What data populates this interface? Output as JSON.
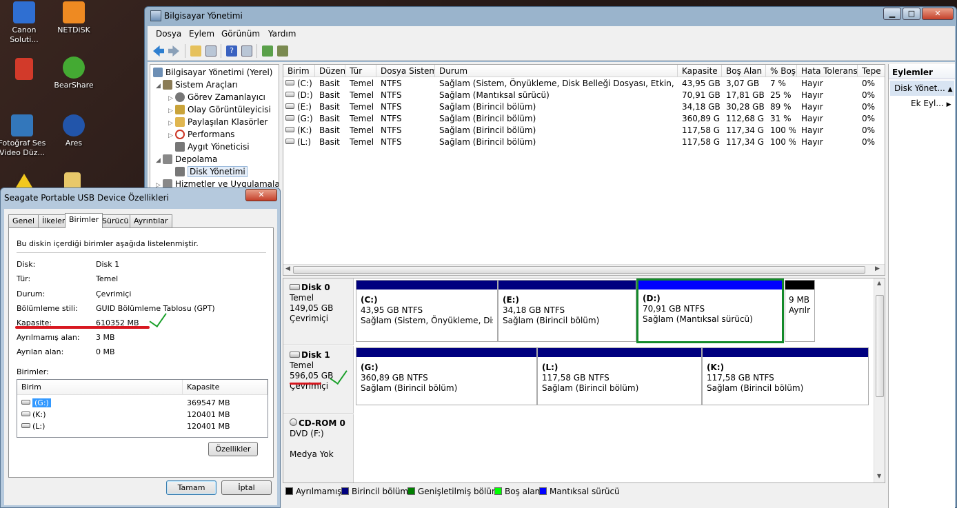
{
  "desktop": {
    "icons": [
      {
        "label": "Canon Soluti...",
        "color": "#2f6fd2"
      },
      {
        "label": "NETDiSK",
        "color": "#ee8a22"
      },
      {
        "label": "",
        "color": "#d23a2a"
      },
      {
        "label": "BearShare",
        "color": "#44aa33"
      },
      {
        "label": "Fotoğraf Ses Video Düz...",
        "color": "#3377bb"
      },
      {
        "label": "Ares",
        "color": "#2255aa"
      }
    ]
  },
  "window": {
    "title": "Bilgisayar Yönetimi",
    "menu": [
      "Dosya",
      "Eylem",
      "Görünüm",
      "Yardım"
    ]
  },
  "tree": {
    "items": [
      {
        "label": "Bilgisayar Yönetimi (Yerel)",
        "color": "#6d8fb5"
      },
      {
        "label": "Sistem Araçları",
        "color": "#8a7b55"
      },
      {
        "label": "Görev Zamanlayıcı",
        "color": "#777"
      },
      {
        "label": "Olay Görüntüleyicisi",
        "color": "#c9a33a"
      },
      {
        "label": "Paylaşılan Klasörler",
        "color": "#e0b650"
      },
      {
        "label": "Performans",
        "color": "#cc3322"
      },
      {
        "label": "Aygıt Yöneticisi",
        "color": "#777"
      },
      {
        "label": "Depolama",
        "color": "#888"
      },
      {
        "label": "Disk Yönetimi",
        "color": "#777"
      },
      {
        "label": "Hizmetler ve Uygulamalar",
        "color": "#888"
      }
    ]
  },
  "volumes": {
    "headers": [
      "Birim",
      "Düzen",
      "Tür",
      "Dosya Sistemi",
      "Durum",
      "Kapasite",
      "Boş Alan",
      "% Boş",
      "Hata Toleransı",
      "Tepe"
    ],
    "rows": [
      [
        "(C:)",
        "Basit",
        "Temel",
        "NTFS",
        "Sağlam (Sistem, Önyükleme, Disk Belleği Dosyası, Etkin, Kilitlen...",
        "43,95 GB",
        "3,07 GB",
        "7 %",
        "Hayır",
        "0%"
      ],
      [
        "(D:)",
        "Basit",
        "Temel",
        "NTFS",
        "Sağlam (Mantıksal sürücü)",
        "70,91 GB",
        "17,81 GB",
        "25 %",
        "Hayır",
        "0%"
      ],
      [
        "(E:)",
        "Basit",
        "Temel",
        "NTFS",
        "Sağlam (Birincil bölüm)",
        "34,18 GB",
        "30,28 GB",
        "89 %",
        "Hayır",
        "0%"
      ],
      [
        "(G:)",
        "Basit",
        "Temel",
        "NTFS",
        "Sağlam (Birincil bölüm)",
        "360,89 GB",
        "112,68 GB",
        "31 %",
        "Hayır",
        "0%"
      ],
      [
        "(K:)",
        "Basit",
        "Temel",
        "NTFS",
        "Sağlam (Birincil bölüm)",
        "117,58 GB",
        "117,34 GB",
        "100 %",
        "Hayır",
        "0%"
      ],
      [
        "(L:)",
        "Basit",
        "Temel",
        "NTFS",
        "Sağlam (Birincil bölüm)",
        "117,58 GB",
        "117,34 GB",
        "100 %",
        "Hayır",
        "0%"
      ]
    ]
  },
  "disks": [
    {
      "name": "Disk 0",
      "type": "Temel",
      "size": "149,05 GB",
      "status": "Çevrimiçi"
    },
    {
      "name": "Disk 1",
      "type": "Temel",
      "size": "596,05 GB",
      "status": "Çevrimiçi"
    },
    {
      "name": "CD-ROM 0",
      "type": "DVD (F:)",
      "size": "",
      "status": "Medya Yok"
    }
  ],
  "partitions": {
    "c": {
      "letter": "(C:)",
      "size": "43,95 GB NTFS",
      "status": "Sağlam (Sistem, Önyükleme, Disk Be"
    },
    "e": {
      "letter": "(E:)",
      "size": "34,18 GB NTFS",
      "status": "Sağlam (Birincil bölüm)"
    },
    "d": {
      "letter": "(D:)",
      "size": "70,91 GB NTFS",
      "status": "Sağlam (Mantıksal sürücü)"
    },
    "u": {
      "letter": "",
      "size": "9 MB",
      "status": "Ayrılr"
    },
    "g": {
      "letter": "(G:)",
      "size": "360,89 GB NTFS",
      "status": "Sağlam (Birincil bölüm)"
    },
    "l": {
      "letter": "(L:)",
      "size": "117,58 GB NTFS",
      "status": "Sağlam (Birincil bölüm)"
    },
    "k": {
      "letter": "(K:)",
      "size": "117,58 GB NTFS",
      "status": "Sağlam (Birincil bölüm)"
    }
  },
  "legend": [
    {
      "label": "Ayrılmamış",
      "color": "#000000"
    },
    {
      "label": "Birincil bölüm",
      "color": "#00007f"
    },
    {
      "label": "Genişletilmiş bölüm",
      "color": "#008000"
    },
    {
      "label": "Boş alan",
      "color": "#00ff00"
    },
    {
      "label": "Mantıksal sürücü",
      "color": "#0000ff"
    }
  ],
  "actions": {
    "header": "Eylemler",
    "selected": "Disk Yönet...",
    "sub": "Ek Eyl..."
  },
  "dialog": {
    "title": "Seagate Portable USB Device Özellikleri",
    "tabs": [
      "Genel",
      "İlkeler",
      "Birimler",
      "Sürücü",
      "Ayrıntılar"
    ],
    "intro": "Bu diskin içerdiği birimler aşağıda listelenmiştir.",
    "props": [
      {
        "label": "Disk:",
        "value": "Disk 1"
      },
      {
        "label": "Tür:",
        "value": "Temel"
      },
      {
        "label": "Durum:",
        "value": "Çevrimiçi"
      },
      {
        "label": "Bölümleme stili:",
        "value": "GUID Bölümleme Tablosu (GPT)"
      },
      {
        "label": "Kapasite:",
        "value": "610352 MB"
      },
      {
        "label": "Ayrılmamış alan:",
        "value": "3 MB"
      },
      {
        "label": "Ayrılan alan:",
        "value": "0 MB"
      }
    ],
    "volumes_label": "Birimler:",
    "list_headers": [
      "Birim",
      "Kapasite"
    ],
    "list_rows": [
      [
        "(G:)",
        "369547 MB"
      ],
      [
        "(K:)",
        "120401 MB"
      ],
      [
        "(L:)",
        "120401 MB"
      ]
    ],
    "props_button": "Özellikler",
    "ok": "Tamam",
    "cancel": "İptal"
  }
}
